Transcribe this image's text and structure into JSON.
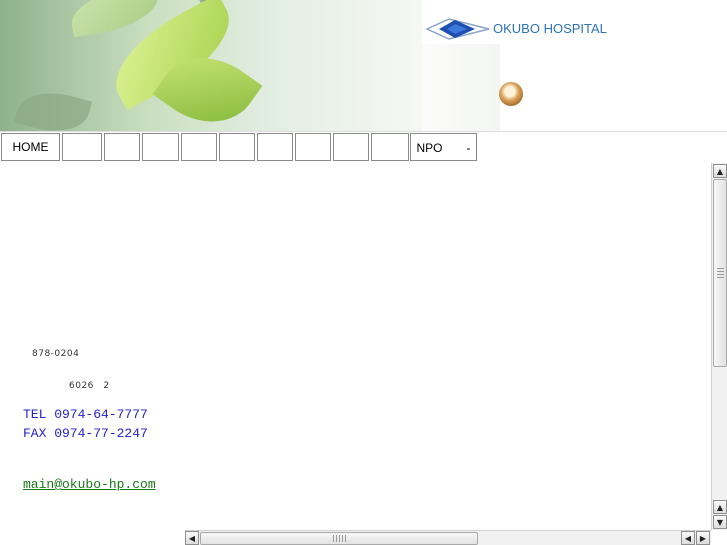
{
  "header": {
    "hospital_name": "OKUBO HOSPITAL",
    "logo_icon": "diamond-logo-icon",
    "badge_icon": "seal-badge-icon",
    "brand_color": "#2b73b5"
  },
  "nav": {
    "items": [
      {
        "label": "HOME"
      },
      {
        "label": ""
      },
      {
        "label": ""
      },
      {
        "label": ""
      },
      {
        "label": ""
      },
      {
        "label": ""
      },
      {
        "label": ""
      },
      {
        "label": ""
      },
      {
        "label": ""
      },
      {
        "label": ""
      },
      {
        "label": "NPO　　-"
      }
    ]
  },
  "contact": {
    "postal": "878-0204",
    "address": "6026　2",
    "tel": "TEL 0974-64-7777",
    "fax": "FAX 0974-77-2247",
    "email": "main@okubo-hp.com"
  },
  "scrollbars": {
    "up_icon": "arrow-up-icon",
    "down_icon": "arrow-down-icon",
    "left_icon": "arrow-left-icon",
    "right_icon": "arrow-right-icon"
  }
}
